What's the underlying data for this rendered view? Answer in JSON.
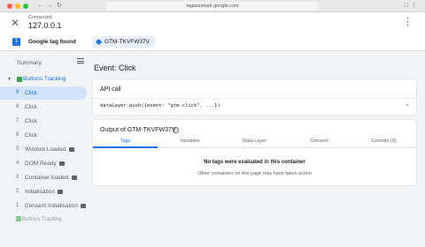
{
  "browser": {
    "url": "tagassistant.google.com"
  },
  "header": {
    "connection_label": "Connected",
    "host": "127.0.0.1"
  },
  "tagbar": {
    "count": "1",
    "label": "Google tag found",
    "container_id": "GTM-TKVFW37V"
  },
  "sidebar": {
    "summary_label": "Summary",
    "group_label": "Buttons Tracking",
    "events": [
      {
        "num": "9",
        "name": "Click",
        "selected": true,
        "badge": false
      },
      {
        "num": "8",
        "name": "Click",
        "selected": false,
        "badge": false
      },
      {
        "num": "7",
        "name": "Click",
        "selected": false,
        "badge": false
      },
      {
        "num": "6",
        "name": "Click",
        "selected": false,
        "badge": false
      },
      {
        "num": "5",
        "name": "Window Loaded",
        "selected": false,
        "badge": true
      },
      {
        "num": "4",
        "name": "DOM Ready",
        "selected": false,
        "badge": true
      },
      {
        "num": "3",
        "name": "Container loaded",
        "selected": false,
        "badge": true
      },
      {
        "num": "2",
        "name": "Initialisation",
        "selected": false,
        "badge": true
      },
      {
        "num": "1",
        "name": "Consent Initialisation",
        "selected": false,
        "badge": true
      }
    ],
    "bottom_label": "Buttons Tracking"
  },
  "main": {
    "event_title": "Event: Click",
    "api_card": {
      "title": "API call",
      "code": "dataLayer.push({event: \"gtm.click\", ...})"
    },
    "output_card": {
      "title": "Output of GTM-TKVFW37V",
      "tabs": [
        "Tags",
        "Variables",
        "Data Layer",
        "Consent",
        "Console (0)"
      ],
      "active_tab": 0,
      "empty_title": "No tags were evaluated in this container",
      "empty_subtitle": "Other containers on this page may have taken action"
    }
  }
}
